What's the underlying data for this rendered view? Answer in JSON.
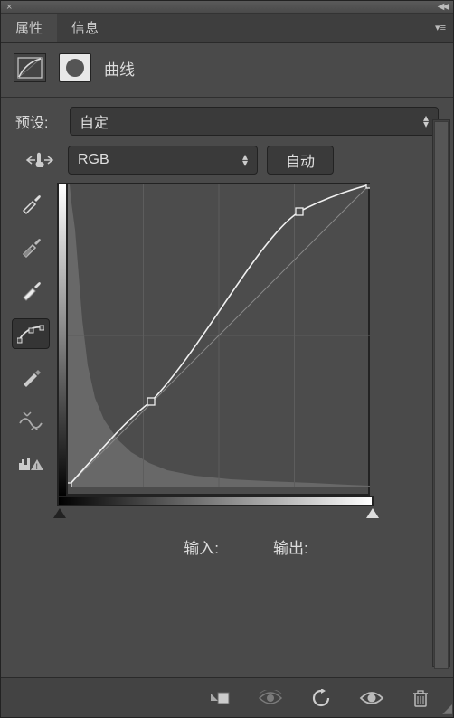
{
  "tabs": {
    "properties": "属性",
    "info": "信息"
  },
  "panel": {
    "title": "曲线"
  },
  "preset": {
    "label": "预设:",
    "value": "自定"
  },
  "channel": {
    "value": "RGB",
    "auto": "自动"
  },
  "io": {
    "input": "输入:",
    "output": "输出:"
  },
  "chart_data": {
    "type": "line",
    "title": "曲线",
    "xlabel": "输入",
    "ylabel": "输出",
    "xlim": [
      0,
      255
    ],
    "ylim": [
      0,
      255
    ],
    "series": [
      {
        "name": "baseline",
        "x": [
          0,
          255
        ],
        "y": [
          0,
          255
        ]
      },
      {
        "name": "curve",
        "x": [
          0,
          70,
          195,
          255
        ],
        "y": [
          0,
          72,
          232,
          255
        ]
      }
    ],
    "control_points": [
      {
        "x": 0,
        "y": 0
      },
      {
        "x": 70,
        "y": 72
      },
      {
        "x": 195,
        "y": 232
      },
      {
        "x": 255,
        "y": 255
      }
    ],
    "grid": {
      "x_divisions": 4,
      "y_divisions": 4
    },
    "histogram_hint": "heavy-shadows"
  }
}
